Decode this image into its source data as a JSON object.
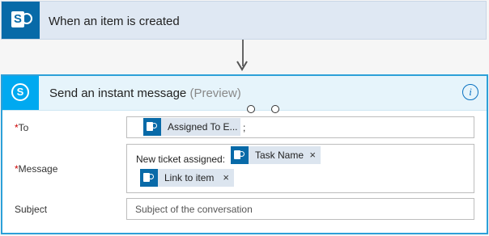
{
  "trigger": {
    "title": "When an item is created",
    "icon": "sharepoint-icon"
  },
  "action": {
    "title": "Send an instant message",
    "preview": "(Preview)",
    "icon": "skype-icon",
    "info_glyph": "i",
    "fields": {
      "to": {
        "required_mark": "*",
        "label": "To",
        "token": "Assigned To E...",
        "suffix": ";"
      },
      "message": {
        "required_mark": "*",
        "label": "Message",
        "prefix_text": "New ticket assigned:",
        "tokens": [
          "Task Name",
          "Link to item"
        ]
      },
      "subject": {
        "label": "Subject",
        "placeholder": "Subject of the conversation"
      }
    }
  },
  "colors": {
    "sharepoint": "#086aa8",
    "skype": "#00a9f0",
    "card_border": "#2da0d8",
    "required": "#cc0000"
  },
  "remove_glyph": "×"
}
